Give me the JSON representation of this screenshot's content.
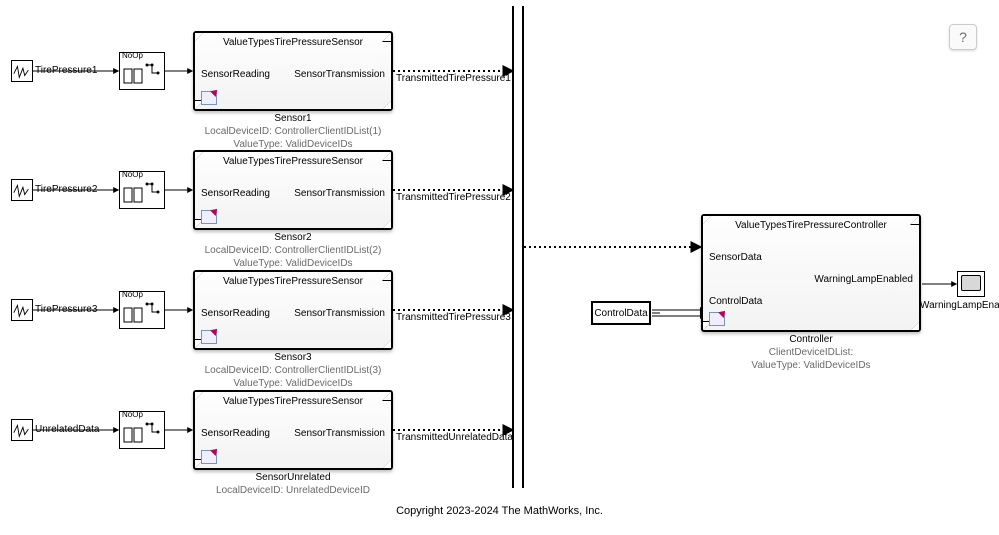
{
  "sources": [
    {
      "label": "TirePressure1"
    },
    {
      "label": "TirePressure2"
    },
    {
      "label": "TirePressure3"
    },
    {
      "label": "UnrelatedData"
    }
  ],
  "noop_label": "NoOp",
  "sensors": [
    {
      "type_title": "ValueTypesTirePressureSensor",
      "in_port": "SensorReading",
      "out_port": "SensorTransmission",
      "name": "Sensor1",
      "signal_label": "TransmittedTirePressure1",
      "params": [
        "LocalDeviceID: ControllerClientIDList(1)",
        "ValueType: ValidDeviceIDs"
      ]
    },
    {
      "type_title": "ValueTypesTirePressureSensor",
      "in_port": "SensorReading",
      "out_port": "SensorTransmission",
      "name": "Sensor2",
      "signal_label": "TransmittedTirePressure2",
      "params": [
        "LocalDeviceID: ControllerClientIDList(2)",
        "ValueType: ValidDeviceIDs"
      ]
    },
    {
      "type_title": "ValueTypesTirePressureSensor",
      "in_port": "SensorReading",
      "out_port": "SensorTransmission",
      "name": "Sensor3",
      "signal_label": "TransmittedTirePressure3",
      "params": [
        "LocalDeviceID: ControllerClientIDList(3)",
        "ValueType: ValidDeviceIDs"
      ]
    },
    {
      "type_title": "ValueTypesTirePressureSensor",
      "in_port": "SensorReading",
      "out_port": "SensorTransmission",
      "name": "SensorUnrelated",
      "signal_label": "TransmittedUnrelatedData",
      "params": [
        "LocalDeviceID: UnrelatedDeviceID"
      ]
    }
  ],
  "controller": {
    "type_title": "ValueTypesTirePressureController",
    "in1": "SensorData",
    "in2": "ControlData",
    "out": "WarningLampEnabled",
    "name": "Controller",
    "params": [
      "ClientDeviceIDList:",
      "ValueType: ValidDeviceIDs"
    ]
  },
  "control_const": {
    "label": "ControlData"
  },
  "scope": {
    "label": "WarningLampEnabled"
  },
  "help": {
    "label": "?"
  },
  "footer": "Copyright 2023-2024 The MathWorks, Inc."
}
